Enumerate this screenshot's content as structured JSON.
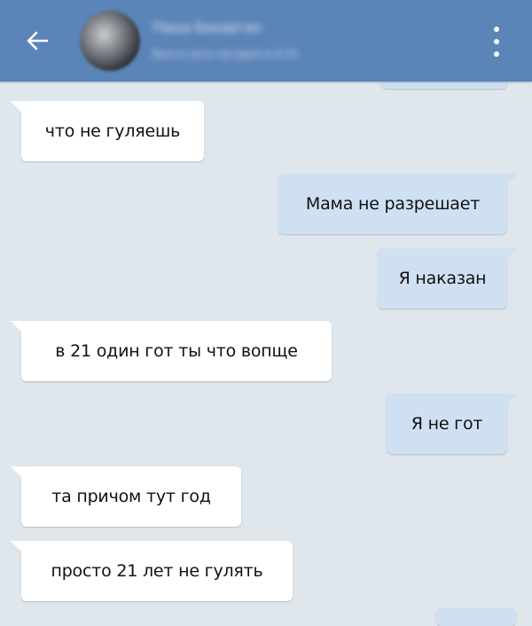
{
  "header": {
    "contact_name": "Паша Бахаргин",
    "status": "был в сети сегодня в 9:15",
    "back_icon": "arrow-left-icon",
    "menu_icon": "more-vertical-icon",
    "background": "#5b84b8"
  },
  "messages": [
    {
      "direction": "incoming",
      "text": "что не гуляешь"
    },
    {
      "direction": "outgoing",
      "text": "Мама не разрешает"
    },
    {
      "direction": "outgoing",
      "text": "Я наказан"
    },
    {
      "direction": "incoming",
      "text": "в 21 один гот ты что вопще"
    },
    {
      "direction": "outgoing",
      "text": "Я не гот"
    },
    {
      "direction": "incoming",
      "text": "та причом тут год"
    },
    {
      "direction": "incoming",
      "text": "просто 21 лет не гулять"
    }
  ],
  "colors": {
    "chat_background": "#dfe6ec",
    "incoming_bubble": "#ffffff",
    "outgoing_bubble": "#cfe0f3"
  }
}
